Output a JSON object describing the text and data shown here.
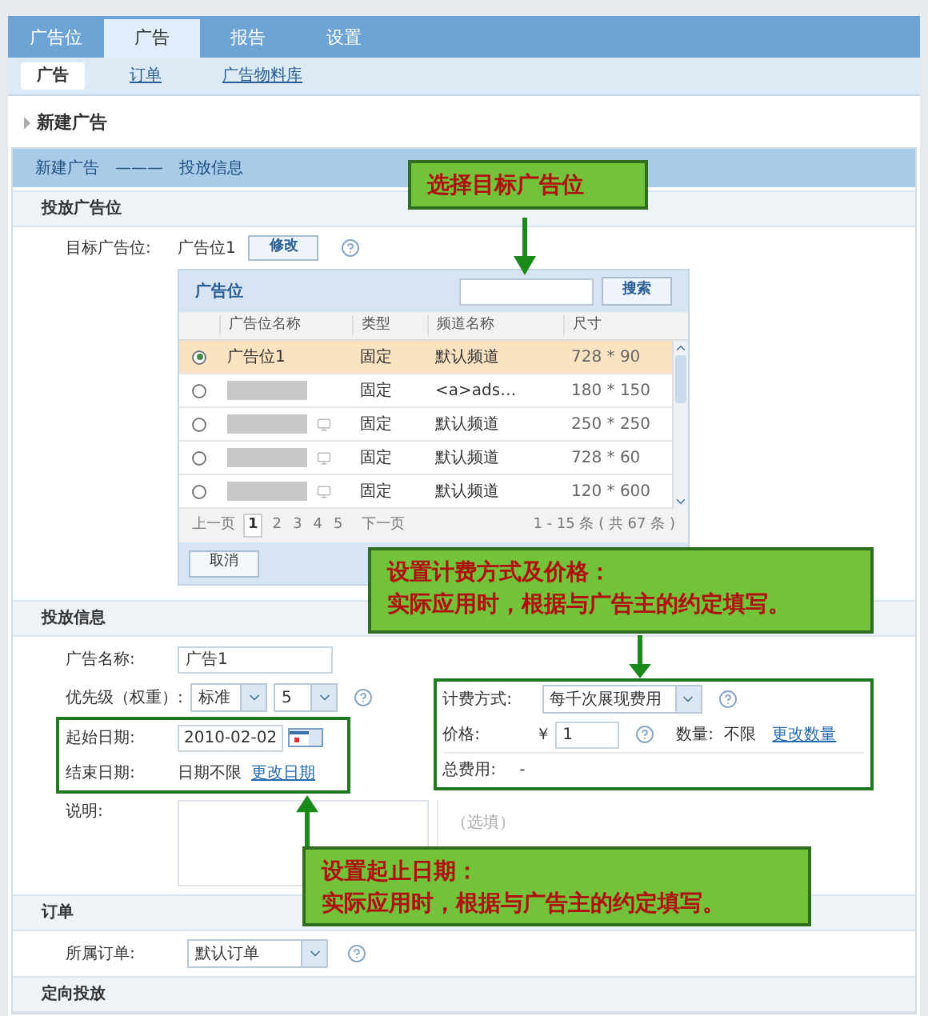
{
  "main_tabs": [
    {
      "label": "广告位",
      "selected": false
    },
    {
      "label": "广告",
      "selected": true
    },
    {
      "label": "报告",
      "selected": false
    },
    {
      "label": "设置",
      "selected": false
    }
  ],
  "sub_tabs": [
    {
      "label": "广告",
      "selected": true
    },
    {
      "label": "订单",
      "selected": false
    },
    {
      "label": "广告物料库",
      "selected": false
    }
  ],
  "page_title": "新建广告",
  "breadcrumb": {
    "first": "新建广告",
    "separator": "———",
    "second": "投放信息"
  },
  "placement_section": {
    "title": "投放广告位",
    "target_label": "目标广告位:",
    "target_value": "广告位1",
    "change_button": "修改"
  },
  "picker": {
    "title": "广告位",
    "search_button": "搜索",
    "columns": [
      "广告位名称",
      "类型",
      "频道名称",
      "尺寸"
    ],
    "rows": [
      {
        "selected": true,
        "redacted": false,
        "preview": false,
        "name": "广告位1",
        "type": "固定",
        "channel": "默认频道",
        "size": "728 * 90"
      },
      {
        "selected": false,
        "redacted": true,
        "preview": false,
        "type": "固定",
        "channel": "<a>ads…",
        "size": "180 * 150"
      },
      {
        "selected": false,
        "redacted": true,
        "preview": true,
        "type": "固定",
        "channel": "默认频道",
        "size": "250 * 250"
      },
      {
        "selected": false,
        "redacted": true,
        "preview": true,
        "type": "固定",
        "channel": "默认频道",
        "size": "728 * 60"
      },
      {
        "selected": false,
        "redacted": true,
        "preview": true,
        "type": "固定",
        "channel": "默认频道",
        "size": "120 * 600"
      }
    ],
    "pagination": {
      "prev": "上一页",
      "pages": [
        {
          "label": "1",
          "selected": true
        },
        {
          "label": "2",
          "selected": false
        },
        {
          "label": "3",
          "selected": false
        },
        {
          "label": "4",
          "selected": false
        },
        {
          "label": "5",
          "selected": false
        }
      ],
      "next": "下一页",
      "summary": "1 - 15 条 ( 共 67 条 )"
    },
    "cancel_button": "取消"
  },
  "delivery_section": {
    "title": "投放信息",
    "ad_name": {
      "label": "广告名称:",
      "value": "广告1"
    },
    "priority": {
      "label": "优先级（权重）:",
      "level_value": "标准",
      "weight_value": "5"
    },
    "start_date": {
      "label": "起始日期:",
      "value": "2010-02-02"
    },
    "end_date": {
      "label": "结束日期:",
      "value": "日期不限",
      "link": "更改日期"
    },
    "description": {
      "label": "说明:",
      "note": "（选填）"
    },
    "billing": {
      "method_label": "计费方式:",
      "method_value": "每千次展现费用",
      "price_label": "价格:",
      "currency": "￥",
      "price_value": "1",
      "quantity_label": "数量:",
      "quantity_value": "不限",
      "quantity_link": "更改数量",
      "total_label": "总费用:",
      "total_value": "-"
    }
  },
  "order_section": {
    "title": "订单",
    "label": "所属订单:",
    "value": "默认订单"
  },
  "targeting_section": {
    "title": "定向投放"
  },
  "callouts": [
    {
      "lines": [
        "选择目标广告位"
      ]
    },
    {
      "lines": [
        "设置计费方式及价格：",
        "实际应用时，根据与广告主的约定填写。"
      ]
    },
    {
      "lines": [
        "设置起止日期：",
        "实际应用时，根据与广告主的约定填写。"
      ]
    }
  ]
}
